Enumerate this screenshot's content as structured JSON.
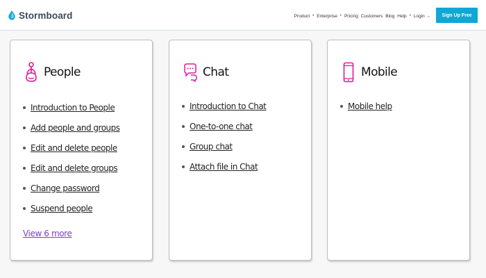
{
  "brand": {
    "name": "Stormboard",
    "accent_color": "#0fa7d6"
  },
  "nav": {
    "product": "Product",
    "enterprise": "Enterprise",
    "pricing": "Pricing",
    "customers": "Customers",
    "blog": "Blog",
    "help": "Help",
    "login": "Login →",
    "signup": "Sign Up Free",
    "separator": "•"
  },
  "cards": {
    "people": {
      "title": "People",
      "icon": "person-meditating-icon",
      "links": [
        "Introduction to People",
        "Add people and groups",
        "Edit and delete people",
        "Edit and delete groups",
        "Change password",
        "Suspend people"
      ],
      "view_more": "View 6 more"
    },
    "chat": {
      "title": "Chat",
      "icon": "chat-bubbles-icon",
      "links": [
        "Introduction to Chat",
        "One-to-one chat",
        "Group chat",
        "Attach file in Chat"
      ]
    },
    "mobile": {
      "title": "Mobile",
      "icon": "mobile-phone-icon",
      "links": [
        "Mobile help"
      ]
    }
  },
  "colors": {
    "icon_magenta": "#e0189a",
    "view_more": "#7a3fc2"
  }
}
